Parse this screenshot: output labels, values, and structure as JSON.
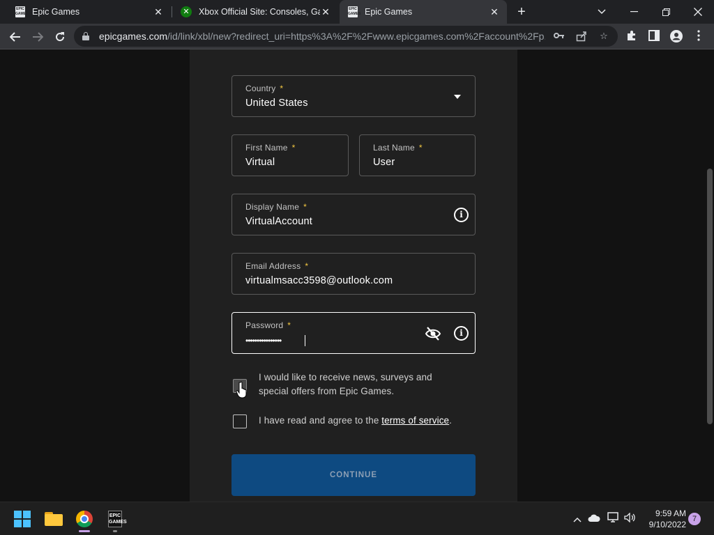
{
  "browser": {
    "tabs": [
      {
        "title": "Epic Games",
        "favicon": "epic-games-icon",
        "active": false
      },
      {
        "title": "Xbox Official Site: Consoles, Gam",
        "favicon": "xbox-icon",
        "active": false
      },
      {
        "title": "Epic Games",
        "favicon": "epic-games-icon",
        "active": true
      }
    ],
    "url_host": "epicgames.com",
    "url_path": "/id/link/xbl/new?redirect_uri=https%3A%2F%2Fwww.epicgames.com%2Faccount%2Fp..."
  },
  "form": {
    "country": {
      "label": "Country",
      "required": "*",
      "value": "United States"
    },
    "first_name": {
      "label": "First Name",
      "required": "*",
      "value": "Virtual"
    },
    "last_name": {
      "label": "Last Name",
      "required": "*",
      "value": "User"
    },
    "display_name": {
      "label": "Display Name",
      "required": "*",
      "value": "VirtualAccount"
    },
    "email": {
      "label": "Email Address",
      "required": "*",
      "value": "virtualmsacc3598@outlook.com"
    },
    "password": {
      "label": "Password",
      "required": "*",
      "value": "••••••••••••••••"
    },
    "news_checkbox": {
      "line1": "I would like to receive news, surveys and",
      "line2": "special offers from Epic Games.",
      "checked": false
    },
    "tos_checkbox": {
      "prefix": "I have read and agree to the ",
      "link": "terms of service",
      "suffix": ".",
      "checked": false
    },
    "continue_label": "CONTINUE"
  },
  "taskbar": {
    "time": "9:59 AM",
    "date": "9/10/2022",
    "notifications": "7"
  },
  "colors": {
    "accent_button": "#0e4a81",
    "required_star": "#f4c842",
    "windows_blue": "#4cc2ff"
  }
}
